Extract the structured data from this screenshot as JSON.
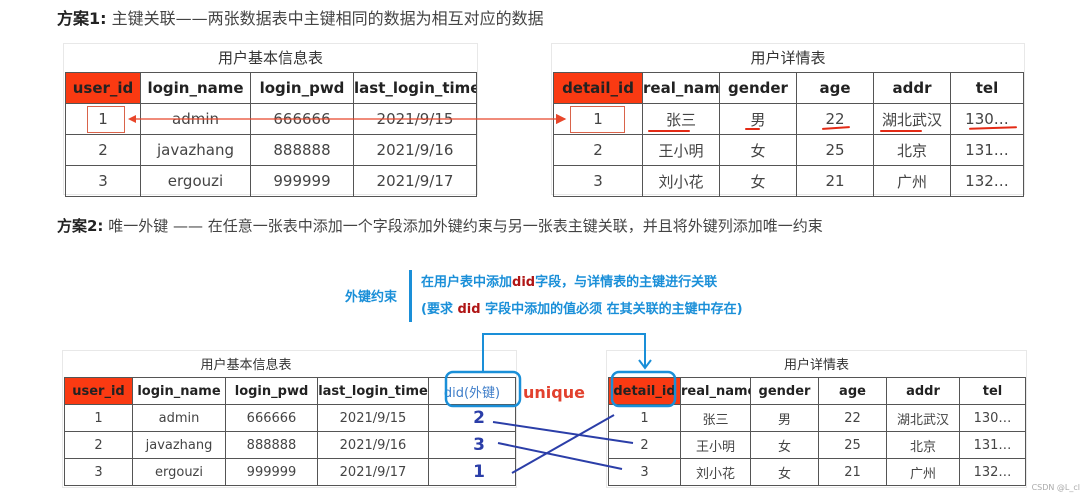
{
  "scheme1": {
    "label": "方案1:",
    "text": "  主键关联——两张数据表中主键相同的数据为相互对应的数据"
  },
  "scheme2": {
    "label": "方案2:",
    "text": " 唯一外键 —— 在任意一张表中添加一个字段添加外键约束与另一张表主键关联，并且将外键列添加唯一约束"
  },
  "user_table": {
    "caption": "用户基本信息表",
    "headers": [
      "user_id",
      "login_name",
      "login_pwd",
      "last_login_time"
    ],
    "rows": [
      [
        "1",
        "admin",
        "666666",
        "2021/9/15"
      ],
      [
        "2",
        "javazhang",
        "888888",
        "2021/9/16"
      ],
      [
        "3",
        "ergouzi",
        "999999",
        "2021/9/17"
      ]
    ]
  },
  "detail_table": {
    "caption": "用户详情表",
    "headers": [
      "detail_id",
      "real_name",
      "gender",
      "age",
      "addr",
      "tel"
    ],
    "rows": [
      [
        "1",
        "张三",
        "男",
        "22",
        "湖北武汉",
        "130…"
      ],
      [
        "2",
        "王小明",
        "女",
        "25",
        "北京",
        "131…"
      ],
      [
        "3",
        "刘小花",
        "女",
        "21",
        "广州",
        "132…"
      ]
    ]
  },
  "fk_note": {
    "label": "外键约束",
    "line1_a": "在用户表中添加",
    "line1_did": "did",
    "line1_b": "字段，与详情表的主键进行关联",
    "line2_a": "(要求 ",
    "line2_did": "did",
    "line2_b": " 字段中添加的值必须 在其关联的主键中存在)"
  },
  "user_table_fk": {
    "caption": "用户基本信息表",
    "headers": [
      "user_id",
      "login_name",
      "login_pwd",
      "last_login_time",
      "did(外键)"
    ],
    "rows": [
      [
        "1",
        "admin",
        "666666",
        "2021/9/15",
        "2"
      ],
      [
        "2",
        "javazhang",
        "888888",
        "2021/9/16",
        "3"
      ],
      [
        "3",
        "ergouzi",
        "999999",
        "2021/9/17",
        "1"
      ]
    ],
    "unique_label": "unique"
  },
  "detail_table_fk": {
    "caption": "用户详情表",
    "headers": [
      "detail_id",
      "real_name",
      "gender",
      "age",
      "addr",
      "tel"
    ],
    "rows": [
      [
        "1",
        "张三",
        "男",
        "22",
        "湖北武汉",
        "130…"
      ],
      [
        "2",
        "王小明",
        "女",
        "25",
        "北京",
        "131…"
      ],
      [
        "3",
        "刘小花",
        "女",
        "21",
        "广州",
        "132…"
      ]
    ]
  },
  "watermark": "CSDN @L_cl",
  "colors": {
    "primary_key_fill": "#fa3a12",
    "relation_arrow": "#e8462a",
    "fk_blue": "#1a8fd8",
    "mapping_line": "#2b3ea8"
  }
}
